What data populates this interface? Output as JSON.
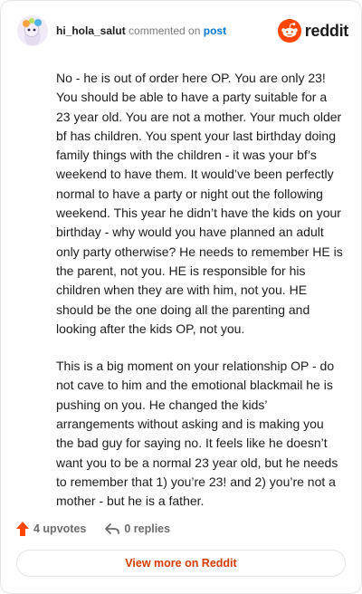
{
  "header": {
    "author": "hi_hola_salut",
    "action": "commented on",
    "post_link": "post",
    "brand": "reddit"
  },
  "comment": {
    "paragraphs": [
      "No - he is out of order here OP. You are only 23! You should be able to have a party suitable for a 23 year old. You are not a mother. Your much older bf has children. You spent your last birthday doing family things with the children - it was your bf’s weekend to have them. It would’ve been perfectly normal to have a party or night out the following weekend. This year he didn’t have the kids on your birthday - why would you have planned an adult only party otherwise? He needs to remember HE is the parent, not you. HE is responsible for his children when they are with him, not you. HE should be the one doing all the parenting and looking after the kids OP, not you.",
      "This is a big moment on your relationship OP - do not cave to him and the emotional blackmail he is pushing on you. He changed the kids’ arrangements without asking and is making you the bad guy for saying no. It feels like he doesn’t want you to be a normal 23 year old, but he needs to remember that 1) you’re 23! and 2) you’re not a mother - but he is a father."
    ]
  },
  "footer": {
    "upvotes": "4 upvotes",
    "replies": "0 replies",
    "view_more": "View more on Reddit"
  },
  "colors": {
    "brand_orange": "#ff4500",
    "link_blue": "#0079d3",
    "view_more_text": "#d93a00"
  }
}
